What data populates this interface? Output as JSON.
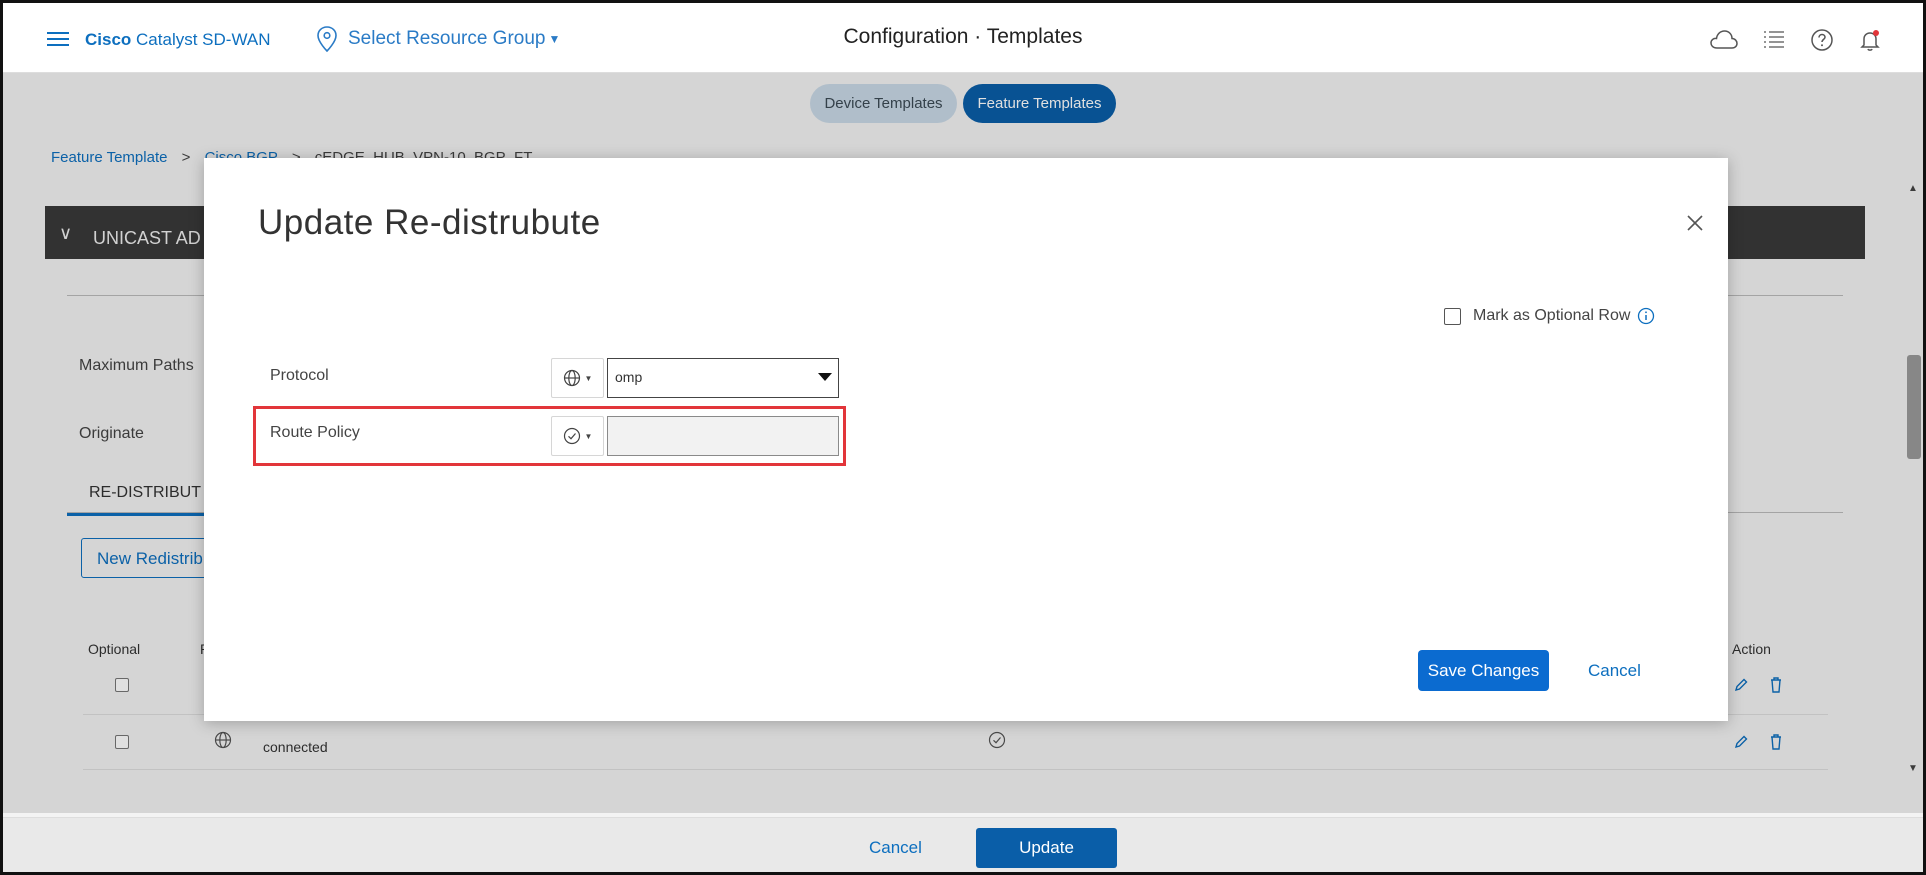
{
  "header": {
    "brand_bold": "Cisco",
    "brand_rest": "Catalyst SD-WAN",
    "resource_group": "Select Resource Group",
    "title_left": "Configuration",
    "title_sep": "·",
    "title_right": "Templates"
  },
  "subtabs": [
    {
      "label": "Device Templates",
      "active": false
    },
    {
      "label": "Feature Templates",
      "active": true
    }
  ],
  "breadcrumb": {
    "items": [
      "Feature Template",
      "Cisco BGP",
      "cEDGE_HUB_VPN-10_BGP_FT"
    ],
    "separator": ">"
  },
  "background": {
    "section_title": "UNICAST AD",
    "labels": {
      "maximum_paths": "Maximum Paths",
      "originate": "Originate"
    },
    "tab": "RE-DISTRIBUT",
    "new_button": "New Redistrib",
    "table": {
      "headers": {
        "optional": "Optional",
        "col2": "P",
        "action": "Action"
      },
      "rows": [
        {
          "protocol": ""
        },
        {
          "protocol": "connected"
        }
      ]
    }
  },
  "modal": {
    "title": "Update Re-distrubute",
    "mark_optional": "Mark as Optional Row",
    "fields": {
      "protocol": {
        "label": "Protocol",
        "value": "omp"
      },
      "route_policy": {
        "label": "Route Policy",
        "value": ""
      }
    },
    "save_label": "Save Changes",
    "cancel_label": "Cancel"
  },
  "footer": {
    "cancel_label": "Cancel",
    "update_label": "Update"
  },
  "colors": {
    "accent": "#0a5ea8",
    "link": "#0d6fbf",
    "highlight": "#e2353a",
    "section_bar": "#3a3a3a"
  }
}
